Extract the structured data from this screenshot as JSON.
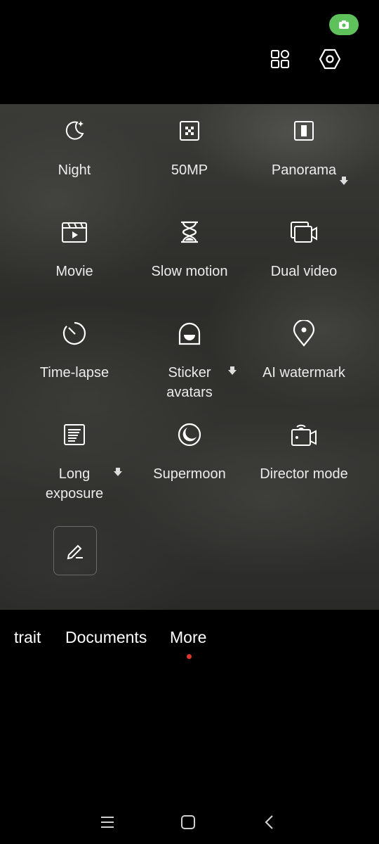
{
  "status": {
    "camera_indicator_icon": "camera-icon",
    "camera_indicator_color": "#5fc15c"
  },
  "top_bar": {
    "grid_icon": "grid-icon",
    "settings_icon": "hexagon-settings-icon"
  },
  "modes": [
    {
      "label": "Night",
      "icon": "moon-stars-icon",
      "download": false
    },
    {
      "label": "50MP",
      "icon": "sensor-icon",
      "download": false
    },
    {
      "label": "Panorama",
      "icon": "panorama-icon",
      "download": true
    },
    {
      "label": "Movie",
      "icon": "film-clapper-icon",
      "download": false
    },
    {
      "label": "Slow motion",
      "icon": "hourglass-icon",
      "download": false
    },
    {
      "label": "Dual video",
      "icon": "dual-video-icon",
      "download": false
    },
    {
      "label": "Time-lapse",
      "icon": "timer-icon",
      "download": false
    },
    {
      "label": "Sticker avatars",
      "icon": "sticker-face-icon",
      "download": true
    },
    {
      "label": "AI watermark",
      "icon": "location-pin-icon",
      "download": false
    },
    {
      "label": "Long exposure",
      "icon": "long-exposure-icon",
      "download": true
    },
    {
      "label": "Supermoon",
      "icon": "supermoon-icon",
      "download": false
    },
    {
      "label": "Director mode",
      "icon": "director-camera-icon",
      "download": false
    }
  ],
  "edit_button": {
    "icon": "pencil-icon"
  },
  "mode_tabs": [
    {
      "label": "trait"
    },
    {
      "label": "Documents"
    },
    {
      "label": "More",
      "active": true
    }
  ],
  "accent_color": "#e0352b",
  "nav": {
    "menu_icon": "menu-icon",
    "home_icon": "home-square-icon",
    "back_icon": "back-chevron-icon"
  }
}
